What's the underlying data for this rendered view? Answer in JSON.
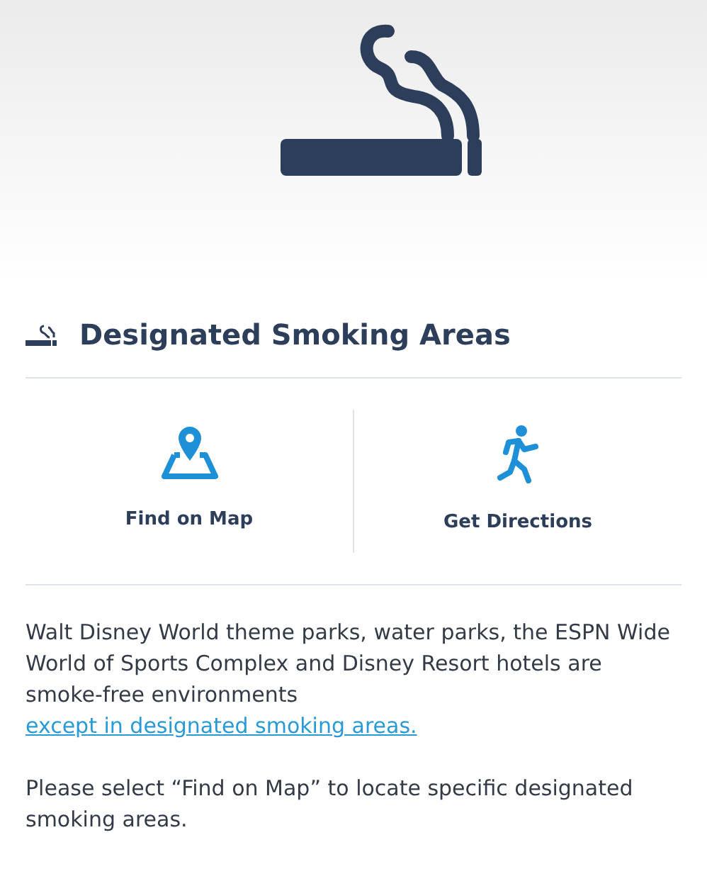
{
  "title": "Designated Smoking Areas",
  "actions": [
    {
      "kind": "map",
      "label": "Find on Map"
    },
    {
      "kind": "directions",
      "label": "Get Directions"
    }
  ],
  "paragraphs": [
    {
      "text": "Walt Disney World theme parks, water parks, the ESPN Wide World of Sports Complex and Disney Resort hotels are smoke-free environments",
      "link": "except in designated smoking areas."
    },
    {
      "text": "Please select “Find on Map” to locate specific designated smoking areas."
    }
  ]
}
